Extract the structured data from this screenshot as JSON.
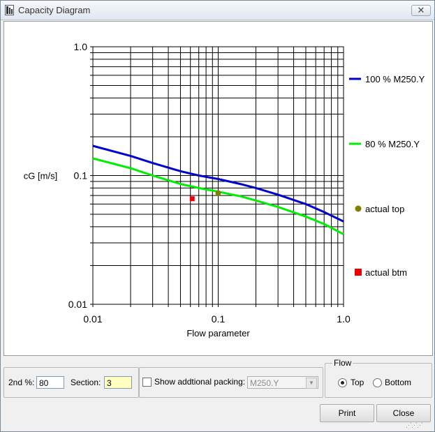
{
  "window": {
    "title": "Capacity Diagram",
    "close_glyph": "✕"
  },
  "chart_data": {
    "type": "line",
    "title": "",
    "xlabel": "Flow parameter",
    "ylabel": "cG [m/s]",
    "xscale": "log",
    "yscale": "log",
    "xlim": [
      0.01,
      1.0
    ],
    "ylim": [
      0.01,
      1.0
    ],
    "x_tick_labels": [
      "0.01",
      "0.1",
      "1.0"
    ],
    "y_tick_labels": [
      "0.01",
      "0.1",
      "1.0"
    ],
    "grid": true,
    "legend_position": "right",
    "series": [
      {
        "name": "100 % M250.Y",
        "color": "#0000cc",
        "kind": "line",
        "x": [
          0.01,
          0.02,
          0.03,
          0.05,
          0.07,
          0.1,
          0.15,
          0.2,
          0.3,
          0.5,
          0.7,
          1.0
        ],
        "y": [
          0.17,
          0.142,
          0.125,
          0.108,
          0.1,
          0.094,
          0.086,
          0.08,
          0.071,
          0.06,
          0.052,
          0.044
        ]
      },
      {
        "name": "80 % M250.Y",
        "color": "#00ee00",
        "kind": "line",
        "x": [
          0.01,
          0.02,
          0.03,
          0.05,
          0.07,
          0.1,
          0.15,
          0.2,
          0.3,
          0.5,
          0.7,
          1.0
        ],
        "y": [
          0.136,
          0.114,
          0.1,
          0.086,
          0.08,
          0.075,
          0.069,
          0.064,
          0.057,
          0.048,
          0.042,
          0.035
        ]
      },
      {
        "name": "actual top",
        "color": "#808000",
        "kind": "point",
        "marker": "circle",
        "x": [
          0.1
        ],
        "y": [
          0.073
        ]
      },
      {
        "name": "actual btm",
        "color": "#ee0000",
        "kind": "point",
        "marker": "square",
        "x": [
          0.062
        ],
        "y": [
          0.066
        ]
      }
    ]
  },
  "controls": {
    "second_pct_label": "2nd %:",
    "second_pct_value": "80",
    "section_label": "Section:",
    "section_value": "3",
    "show_packing_label": "Show addtional packing:",
    "packing_value": "M250.Y",
    "flow_group_label": "Flow",
    "flow_top_label": "Top",
    "flow_bottom_label": "Bottom",
    "print_label": "Print",
    "close_label": "Close"
  }
}
